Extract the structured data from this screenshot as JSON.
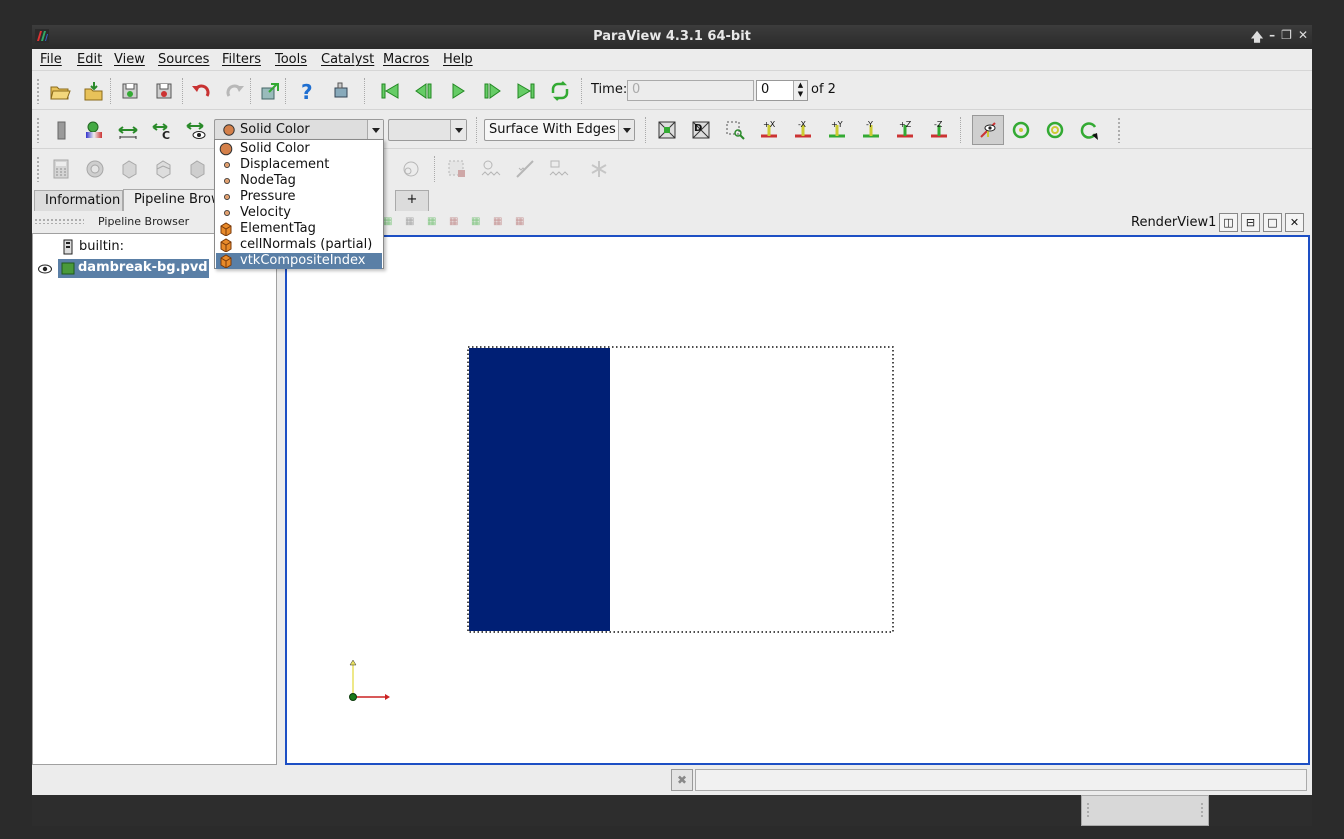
{
  "window": {
    "title": "ParaView 4.3.1 64-bit"
  },
  "menu": [
    "File",
    "Edit",
    "View",
    "Sources",
    "Filters",
    "Tools",
    "Catalyst",
    "Macros",
    "Help"
  ],
  "time": {
    "label": "Time:",
    "value": "0",
    "placeholder": "0",
    "step": "0",
    "of_label": "of 2"
  },
  "display": {
    "coloring": "Solid Color",
    "component": "",
    "representation": "Surface With Edges"
  },
  "coloring_dropdown": {
    "items": [
      {
        "label": "Solid Color",
        "icon": "solid-color-icon"
      },
      {
        "label": "Displacement",
        "icon": "point-data-icon"
      },
      {
        "label": "NodeTag",
        "icon": "point-data-icon"
      },
      {
        "label": "Pressure",
        "icon": "point-data-icon"
      },
      {
        "label": "Velocity",
        "icon": "point-data-icon"
      },
      {
        "label": "ElementTag",
        "icon": "cell-data-icon"
      },
      {
        "label": "cellNormals (partial)",
        "icon": "cell-data-icon"
      },
      {
        "label": "vtkCompositeIndex",
        "icon": "cell-data-icon"
      }
    ],
    "selected": "vtkCompositeIndex"
  },
  "tabs": {
    "information": "Information",
    "pipeline": "Pipeline Brow",
    "add": "+"
  },
  "pipeline_browser": {
    "title": "Pipeline Browser",
    "server": "builtin:",
    "source": "dambreak-bg.pvd"
  },
  "render_view": {
    "title": "RenderView1"
  },
  "colors": {
    "render_border": "#1d4fc4",
    "water_block": "#001f75",
    "selection": "#5a7fa6",
    "title_bar": "#333333"
  }
}
